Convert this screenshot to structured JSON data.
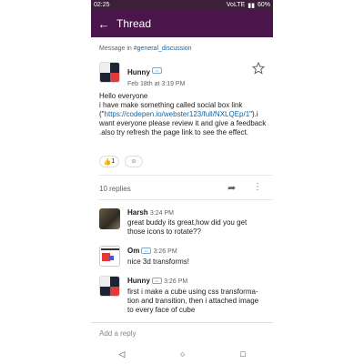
{
  "status": {
    "time": "02:25",
    "battery": "60%",
    "network": "VoLTE"
  },
  "header": {
    "title": "Thread"
  },
  "meta": {
    "prefix": "Message in ",
    "channel": "#general_discussion"
  },
  "parent": {
    "name": "Hunny",
    "time": "Feb 18th at 3:19 PM",
    "line1": "Hello everyone",
    "line2_a": "i have make something called social box link",
    "line2_b": "(\"",
    "link": "https://codepen.io/webster123/full/NXLQEp/1",
    "line2_c": "\").i want everyone please review it and give a feedback .also try refresh the page link to see the effect.",
    "reaction_count": "1",
    "reaction_emoji": "👍"
  },
  "thread": {
    "replies_label": "10 replies"
  },
  "replies": [
    {
      "name": "Harsh",
      "time": "3:24 PM",
      "text": "great buddy its great,how did you get those icons to rotate??"
    },
    {
      "name": "Om",
      "time": "3:26 PM",
      "text": "nice 3d transforms!"
    },
    {
      "name": "Hunny",
      "time": "3:26 PM",
      "text": "first i make a cube using css transforma- tion and transition, then i attached image to every face of cube"
    }
  ],
  "composer": {
    "placeholder": "Add a reply"
  },
  "colors": {
    "appbar": "#4a154b",
    "link": "#1264a3"
  }
}
